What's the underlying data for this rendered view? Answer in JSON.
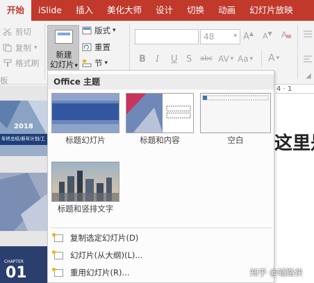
{
  "tabs": [
    "开始",
    "iSlide",
    "插入",
    "美化大师",
    "设计",
    "切换",
    "动画",
    "幻灯片放映"
  ],
  "clipboard": {
    "cut": "剪切",
    "copy": "复制",
    "format_painter": "格式刷",
    "group_fragment": "板"
  },
  "slides_group": {
    "new_slide_line1": "新建",
    "new_slide_line2": "幻灯片",
    "layout": "版式",
    "reset": "重置",
    "section": "节"
  },
  "font": {
    "size": "48"
  },
  "slide_thumb": {
    "year": "2018",
    "subtitle": "年终总结/新年计划/工",
    "number": "01",
    "chapter": "CHAPTER"
  },
  "canvas_text": "这里是",
  "dropdown": {
    "header": "Office 主题",
    "layouts": [
      {
        "label": "标题幻灯片"
      },
      {
        "label": "标题和内容"
      },
      {
        "label": "空白"
      },
      {
        "label": "标题和竖排文字"
      }
    ],
    "menu": [
      {
        "label": "复制选定幻灯片(D)"
      },
      {
        "label": "幻灯片(从大纲)(L)..."
      },
      {
        "label": "重用幻灯片(R)..."
      }
    ]
  },
  "watermark": "知乎 @辅路侠"
}
